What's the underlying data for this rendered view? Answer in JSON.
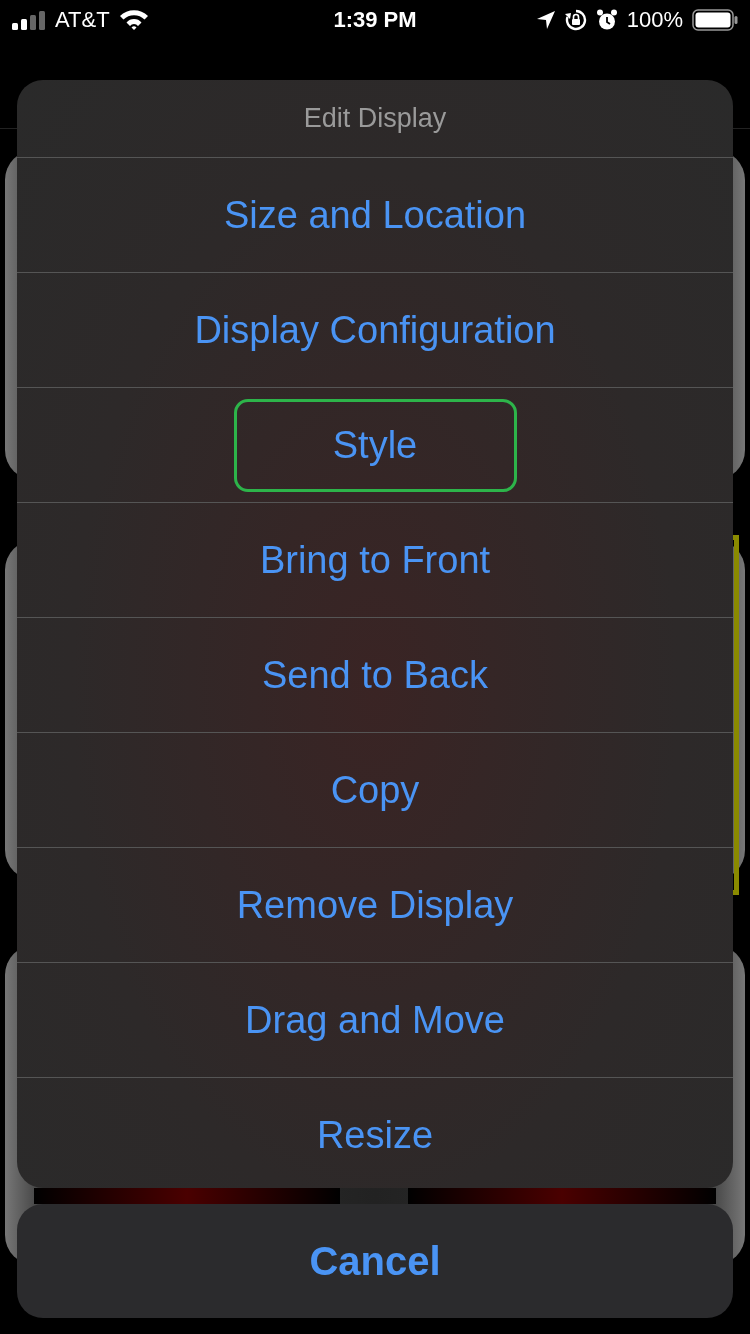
{
  "status_bar": {
    "carrier": "AT&T",
    "time": "1:39 PM",
    "battery": "100%"
  },
  "sheet": {
    "title": "Edit Display",
    "items": [
      {
        "label": "Size and Location",
        "focused": false
      },
      {
        "label": "Display Configuration",
        "focused": false
      },
      {
        "label": "Style",
        "focused": true
      },
      {
        "label": "Bring to Front",
        "focused": false
      },
      {
        "label": "Send to Back",
        "focused": false
      },
      {
        "label": "Copy",
        "focused": false
      },
      {
        "label": "Remove Display",
        "focused": false
      },
      {
        "label": "Drag and Move",
        "focused": false
      },
      {
        "label": "Resize",
        "focused": false
      }
    ],
    "cancel": "Cancel"
  }
}
